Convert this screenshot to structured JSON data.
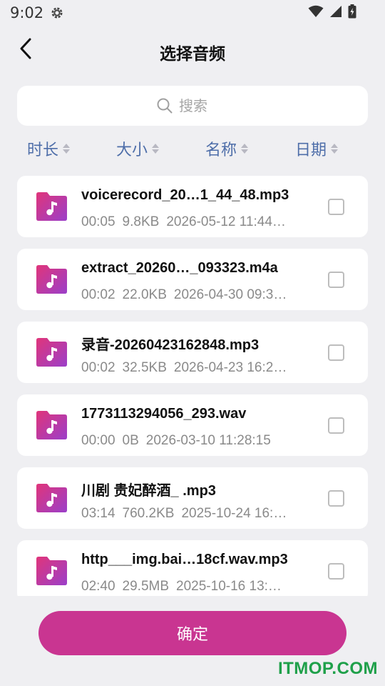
{
  "status_bar": {
    "time": "9:02",
    "icons": [
      "gear-icon",
      "wifi-icon",
      "signal-icon",
      "battery-charging-icon"
    ]
  },
  "header": {
    "title": "选择音频",
    "back_icon": "chevron-left-icon"
  },
  "search": {
    "placeholder": "搜索",
    "icon": "search-icon"
  },
  "sort": [
    {
      "label": "时长"
    },
    {
      "label": "大小"
    },
    {
      "label": "名称"
    },
    {
      "label": "日期"
    }
  ],
  "files": [
    {
      "name": "voicerecord_20…1_44_48.mp3",
      "duration": "00:05",
      "size": "9.8KB",
      "date": "2026-05-12 11:44…",
      "checked": false
    },
    {
      "name": "extract_20260…_093323.m4a",
      "duration": "00:02",
      "size": "22.0KB",
      "date": "2026-04-30 09:3…",
      "checked": false
    },
    {
      "name": "录音-20260423162848.mp3",
      "duration": "00:02",
      "size": "32.5KB",
      "date": "2026-04-23 16:2…",
      "checked": false
    },
    {
      "name": "1773113294056_293.wav",
      "duration": "00:00",
      "size": "0B",
      "date": "2026-03-10 11:28:15",
      "checked": false
    },
    {
      "name": "川剧 贵妃醉酒_ .mp3",
      "duration": "03:14",
      "size": "760.2KB",
      "date": "2025-10-24 16:…",
      "checked": false
    },
    {
      "name": "http___img.bai…18cf.wav.mp3",
      "duration": "02:40",
      "size": "29.5MB",
      "date": "2025-10-16 13:…",
      "checked": false
    }
  ],
  "confirm_label": "确定",
  "watermark": "ITMOP.COM",
  "colors": {
    "accent": "#c93591",
    "sort_text": "#4e6ea9",
    "icon_gradient_start": "#e0357a",
    "icon_gradient_end": "#9b3fc9",
    "background": "#efeff2",
    "watermark": "#1fa04a"
  }
}
